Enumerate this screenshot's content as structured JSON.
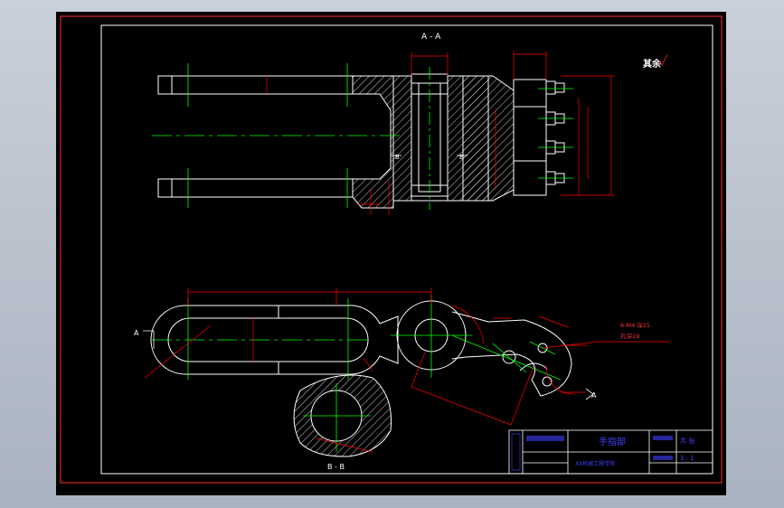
{
  "drawing": {
    "section_aa_label": "A - A",
    "section_bb_label": "B - B",
    "cut_b_left": "B",
    "cut_b_right": "B",
    "cut_a_left": "A",
    "cut_a_right": "A",
    "surface_note": "其余",
    "callout_line1": "6-M4 深15",
    "callout_line2": "孔深19"
  },
  "title_block": {
    "drawing_name": "手指部",
    "company": "XX机械工程学院",
    "qty_label": "共 张",
    "scale": "1 : 1"
  },
  "colors": {
    "background": "#000000",
    "outline": "#ffffff",
    "centerline": "#00ff00",
    "dimension": "#ff0000",
    "border": "#ff3030",
    "title_text": "#4040ff"
  }
}
